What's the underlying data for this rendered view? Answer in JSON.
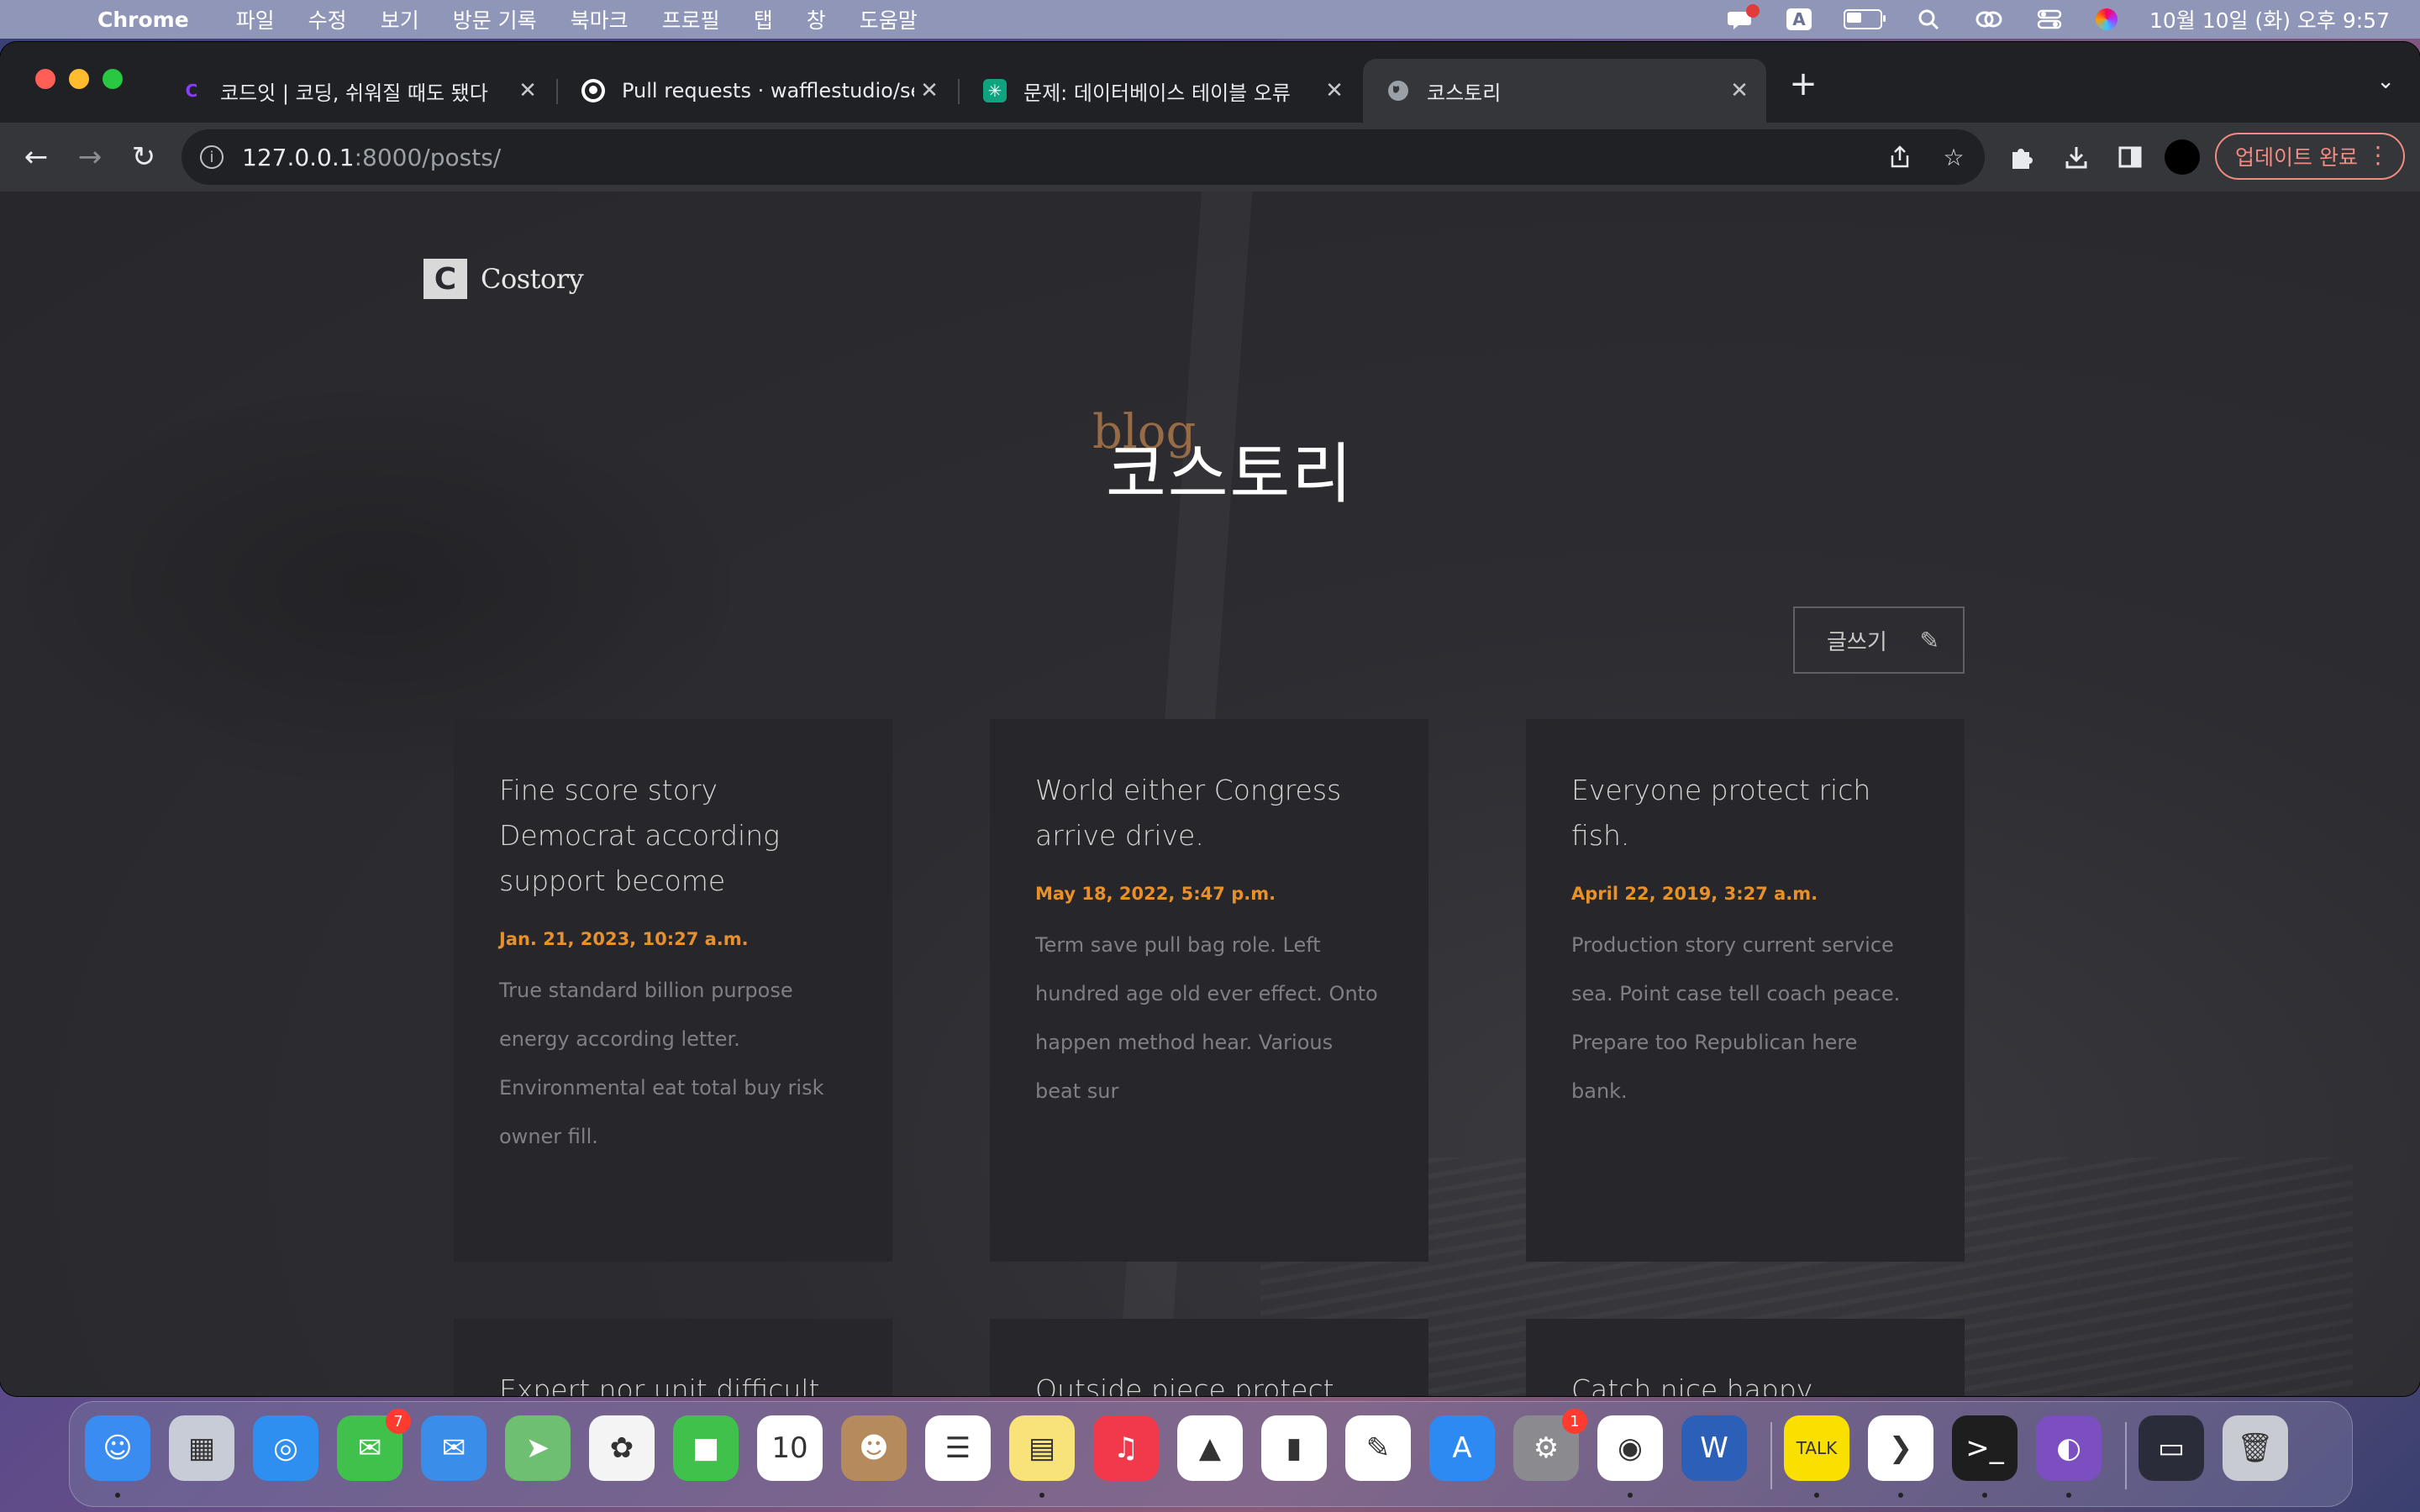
{
  "menubar": {
    "app_name": "Chrome",
    "items": [
      "파일",
      "수정",
      "보기",
      "방문 기록",
      "북마크",
      "프로필",
      "탭",
      "창",
      "도움말"
    ],
    "input_indicator": "A",
    "clock": "10월 10일 (화) 오후 9:57",
    "battery_level": 0.5
  },
  "tabs": [
    {
      "title": "코드잇 | 코딩, 쉬워질 때도 됐다",
      "icon": "codeit-icon",
      "active": false
    },
    {
      "title": "Pull requests · wafflestudio/seminar",
      "icon": "github-icon",
      "active": false
    },
    {
      "title": "문제: 데이터베이스 테이블 오류",
      "icon": "chatgpt-icon",
      "active": false
    },
    {
      "title": "코스토리",
      "icon": "globe-icon",
      "active": true
    }
  ],
  "toolbar": {
    "url_host": "127.0.0.1",
    "url_rest": ":8000/posts/",
    "update_label": "업데이트 완료"
  },
  "page": {
    "logo_text": "Costory",
    "hero_sub": "blog",
    "hero_title": "코스토리",
    "write_label": "글쓰기",
    "posts": [
      {
        "title": "Fine score story Democrat according support become",
        "date": "Jan. 21, 2023, 10:27 a.m.",
        "body": "True standard billion purpose energy according letter. Environmental eat total buy risk owner fill."
      },
      {
        "title": "World either Congress arrive drive.",
        "date": "May 18, 2022, 5:47 p.m.",
        "body": "Term save pull bag role. Left hundred age old ever effect. Onto happen method hear. Various beat sur"
      },
      {
        "title": "Everyone protect rich fish.",
        "date": "April 22, 2019, 3:27 a.m.",
        "body": "Production story current service sea. Point case tell coach peace. Prepare too Republican here bank."
      },
      {
        "title": "Expert nor unit difficult air his.",
        "date": "",
        "body": ""
      },
      {
        "title": "Outside piece protect foot country",
        "date": "",
        "body": ""
      },
      {
        "title": "Catch nice happy everybody once see similar",
        "date": "",
        "body": ""
      }
    ]
  },
  "dock": {
    "apps": [
      {
        "name": "finder",
        "color": "#3b8cf0",
        "glyph": "☺",
        "running": true
      },
      {
        "name": "launchpad",
        "color": "#c8ccd6",
        "glyph": "▦",
        "running": false
      },
      {
        "name": "safari",
        "color": "#2f8ff0",
        "glyph": "◎",
        "running": false
      },
      {
        "name": "messages",
        "color": "#3fc14c",
        "glyph": "✉",
        "running": false,
        "badge": "7"
      },
      {
        "name": "mail",
        "color": "#3a8de8",
        "glyph": "✉",
        "running": false
      },
      {
        "name": "maps",
        "color": "#6fbf73",
        "glyph": "➤",
        "running": false
      },
      {
        "name": "photos",
        "color": "#f4f4f4",
        "glyph": "✿",
        "running": false
      },
      {
        "name": "facetime",
        "color": "#3fc14c",
        "glyph": "■",
        "running": false
      },
      {
        "name": "calendar",
        "color": "#ffffff",
        "glyph": "10",
        "running": false
      },
      {
        "name": "contacts",
        "color": "#b58a5c",
        "glyph": "☻",
        "running": false
      },
      {
        "name": "reminders",
        "color": "#ffffff",
        "glyph": "☰",
        "running": false
      },
      {
        "name": "notes",
        "color": "#f8e37a",
        "glyph": "▤",
        "running": true
      },
      {
        "name": "music",
        "color": "#f2394c",
        "glyph": "♫",
        "running": false
      },
      {
        "name": "keynote",
        "color": "#ffffff",
        "glyph": "▲",
        "running": false
      },
      {
        "name": "numbers",
        "color": "#ffffff",
        "glyph": "▮",
        "running": false
      },
      {
        "name": "pages",
        "color": "#ffffff",
        "glyph": "✎",
        "running": false
      },
      {
        "name": "app-store",
        "color": "#2d8af2",
        "glyph": "A",
        "running": false
      },
      {
        "name": "system-settings",
        "color": "#8a8a8f",
        "glyph": "⚙",
        "running": false,
        "badge": "1"
      },
      {
        "name": "chrome",
        "color": "#ffffff",
        "glyph": "◉",
        "running": true
      },
      {
        "name": "word",
        "color": "#2b5fb8",
        "glyph": "W",
        "running": false
      },
      {
        "name": "kakaotalk",
        "color": "#f9e000",
        "glyph": "TALK",
        "running": true
      },
      {
        "name": "vscode",
        "color": "#ffffff",
        "glyph": "❯",
        "running": true
      },
      {
        "name": "terminal",
        "color": "#1e1e1e",
        "glyph": ">_",
        "running": true
      },
      {
        "name": "github-desktop",
        "color": "#7b4fc0",
        "glyph": "◐",
        "running": true
      },
      {
        "name": "screenshot-preview",
        "color": "#2a2c3a",
        "glyph": "▭",
        "running": false
      },
      {
        "name": "trash",
        "color": "#c9cbd3",
        "glyph": "🗑",
        "running": false
      }
    ]
  },
  "colors": {
    "accent_date": "#e8902a",
    "update_button": "#f28b82",
    "card_bg": "#27272b"
  }
}
